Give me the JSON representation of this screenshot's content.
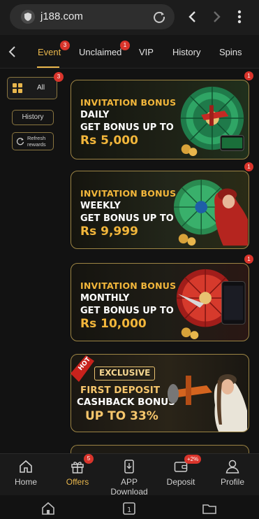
{
  "browser": {
    "url": "j188.com",
    "icons": [
      "site-info-icon",
      "reload-icon",
      "back-arrow-icon",
      "forward-arrow-icon",
      "more-vert-icon"
    ]
  },
  "tabs": [
    {
      "label": "Event",
      "active": true,
      "badge": "3"
    },
    {
      "label": "Unclaimed",
      "active": false,
      "badge": "1"
    },
    {
      "label": "VIP",
      "active": false
    },
    {
      "label": "History",
      "active": false
    },
    {
      "label": "Spins",
      "active": false
    }
  ],
  "sidebar": {
    "all_label": "All",
    "all_badge": "3",
    "history_label": "History",
    "refresh_label_1": "Refresh",
    "refresh_label_2": "rewards"
  },
  "banners": [
    {
      "line1": "INVITATION BONUS",
      "line2": "DAILY",
      "line3": "GET BONUS UP TO",
      "amount": "Rs 5,000",
      "badge": "1"
    },
    {
      "line1": "INVITATION BONUS",
      "line2": "WEEKLY",
      "line3": "GET BONUS UP TO",
      "amount": "Rs 9,999",
      "badge": "1"
    },
    {
      "line1": "INVITATION BONUS",
      "line2": "MONTHLY",
      "line3": "GET BONUS UP TO",
      "amount": "Rs 10,000",
      "badge": "1"
    }
  ],
  "promo": {
    "ribbon": "HOT",
    "tag": "EXCLUSIVE",
    "line2": "FIRST DEPOSIT",
    "line3": "CASHBACK BONUS",
    "line4": "UP TO 33%"
  },
  "bottom_nav": [
    {
      "label": "Home",
      "icon": "home-icon"
    },
    {
      "label": "Offers",
      "icon": "gift-icon",
      "badge": "5",
      "active": true
    },
    {
      "label": "APP Download",
      "icon": "phone-download-icon"
    },
    {
      "label": "Deposit",
      "icon": "wallet-icon",
      "badge": "+2%"
    },
    {
      "label": "Profile",
      "icon": "profile-icon"
    }
  ],
  "colors": {
    "accent_gold": "#e8b64c",
    "badge_red": "#d9342b",
    "background": "#121212"
  }
}
